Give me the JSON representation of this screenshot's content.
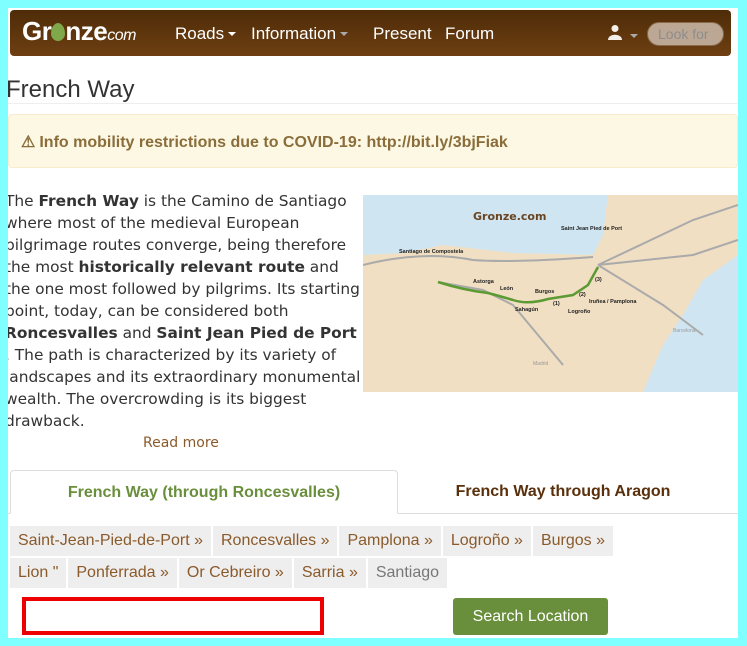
{
  "navbar": {
    "logo_text": "Gronze",
    "logo_suffix": "com",
    "items": [
      {
        "label": "Roads",
        "dropdown": true
      },
      {
        "label": "Information",
        "dropdown": true
      },
      {
        "label": "Present"
      },
      {
        "label": "Forum"
      }
    ],
    "user_icon": "user-icon",
    "search_placeholder": "Look for"
  },
  "page": {
    "title": "French Way",
    "alert": "Info mobility restrictions due to COVID-19: http://bit.ly/3bjFiak",
    "alert_icon": "warning-triangle-icon",
    "intro": [
      {
        "t": "The "
      },
      {
        "b": "French Way"
      },
      {
        "t": " is the Camino de Santiago where most of the medieval European pilgrimage routes converge, being therefore the most "
      },
      {
        "b": "historically relevant route"
      },
      {
        "t": " and the one most followed by pilgrims. Its starting point, today, can be considered both "
      },
      {
        "b": "Roncesvalles"
      },
      {
        "t": " and "
      },
      {
        "b": "Saint Jean Pied de Port"
      },
      {
        "t": " . The path is characterized by its variety of landscapes and its extraordinary monumental wealth. The overcrowding is its biggest drawback."
      }
    ],
    "read_more": "Read more",
    "map": {
      "logo": "Gronze.com",
      "labels": [
        "Santiago de Compostela",
        "Astorga",
        "León",
        "Sahagún",
        "Burgos",
        "(1)",
        "Logroño",
        "(2)",
        "Iruñea / Pamplona",
        "(3)",
        "Saint Jean Pied de Port",
        "Madrid",
        "Barcelona"
      ]
    }
  },
  "tabs": [
    {
      "label": "French Way (through Roncesvalles)",
      "active": true
    },
    {
      "label": "French Way through Aragon",
      "active": false
    }
  ],
  "stages": [
    "Saint-Jean-Pied-de-Port »",
    "Roncesvalles »",
    "Pamplona »",
    "Logroño »",
    "Burgos »",
    "Lion \"",
    "Ponferrada »",
    "Or Cebreiro »",
    "Sarria »",
    "Santiago"
  ],
  "search": {
    "value": "",
    "button": "Search Location"
  },
  "colors": {
    "accent_green": "#6a8f3c",
    "brown": "#8b5a2b",
    "navbar": "#5e3510",
    "highlight": "#ee0000"
  }
}
